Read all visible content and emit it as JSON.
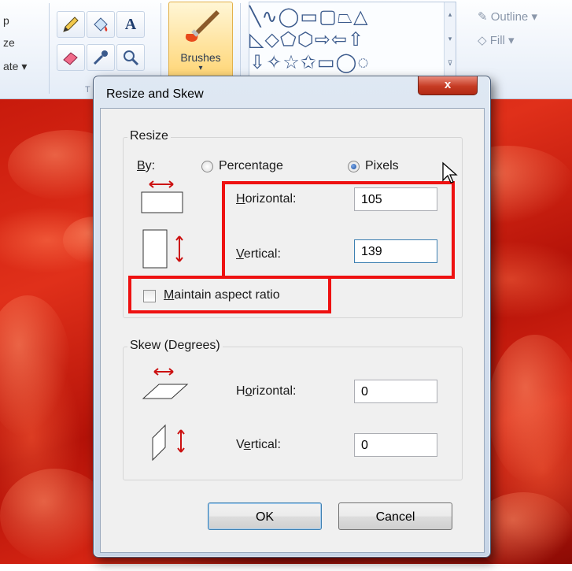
{
  "ribbon": {
    "left_labels": [
      "p",
      "ze",
      "ate ▾"
    ],
    "tool_icons": [
      "pencil-icon",
      "fill-bucket-icon",
      "text-icon",
      "eraser-icon",
      "color-picker-icon",
      "magnifier-icon"
    ],
    "text_tool_glyph": "A",
    "tools_caption": "T",
    "brushes_label": "Brushes",
    "brushes_arrow": "▾",
    "shapes_rows": [
      "╲∿◯▭▢⏢△",
      "◺◇⬠⬡⇨⇦⇧",
      "⇩✧☆✩▭◯◌"
    ],
    "outline_label": "Outline ▾",
    "fill_label": "Fill ▾",
    "outline_icon": "pencil-outline-icon",
    "fill_icon": "fill-icon",
    "scroll_glyphs": [
      "▴",
      "▾",
      "⊽"
    ]
  },
  "dialog": {
    "title": "Resize and Skew",
    "close_glyph": "x",
    "resize": {
      "group_label": "Resize",
      "by_label_u": "B",
      "by_label_rest": "y:",
      "options": [
        {
          "label": "Percentage",
          "selected": false
        },
        {
          "label": "Pixels",
          "selected": true
        }
      ],
      "horizontal_label_u": "H",
      "horizontal_label_rest": "orizontal:",
      "horizontal_value": "105",
      "vertical_label_u": "V",
      "vertical_label_rest": "ertical:",
      "vertical_value": "139",
      "maintain_aspect_u": "M",
      "maintain_aspect_rest": "aintain aspect ratio",
      "maintain_aspect_checked": false
    },
    "skew": {
      "group_label": "Skew (Degrees)",
      "horizontal_label_pre": "H",
      "horizontal_label_u": "o",
      "horizontal_label_rest": "rizontal:",
      "horizontal_value": "0",
      "vertical_label_pre": "V",
      "vertical_label_u": "e",
      "vertical_label_rest": "rtical:",
      "vertical_value": "0"
    },
    "ok_label": "OK",
    "cancel_label": "Cancel"
  },
  "colors": {
    "highlight": "#ee1111",
    "arrow_red": "#cc1111"
  }
}
